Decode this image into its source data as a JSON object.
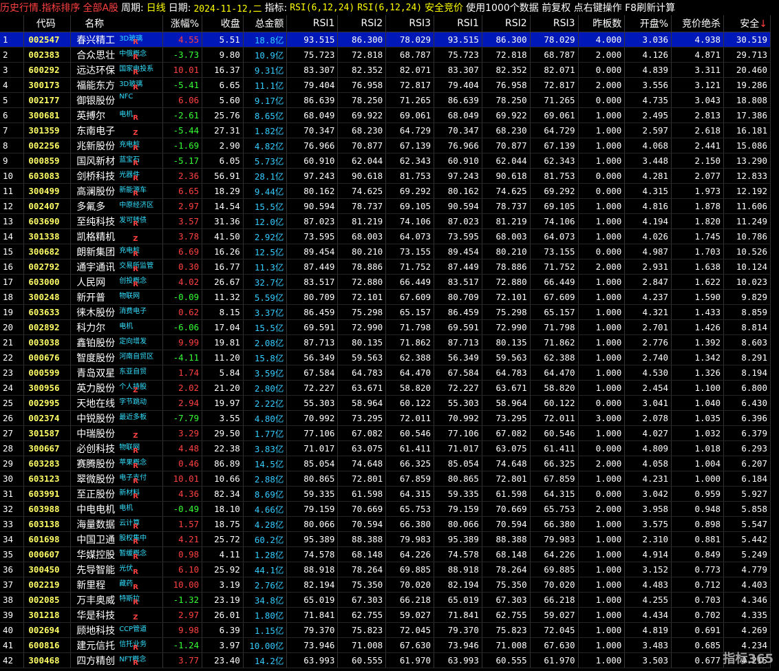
{
  "title_bar": {
    "mode": "历史行情.指标排序",
    "scope": "全部A股",
    "period_label": "周期:",
    "period_value": "日线",
    "date_label": "日期:",
    "date_value": "2024-11-12,二",
    "indicator_label": "指标:",
    "indicator_value": "RSI(6,12,24)",
    "indicator_value2": "RSI(6,12,24)",
    "strategy": "安全竞价",
    "info": "使用1000个数据 前复权 点右键操作 F8刷新计算"
  },
  "columns": [
    "",
    "代码",
    "名称",
    "涨幅%",
    "收盘",
    "总金额",
    "RSI1",
    "RSI2",
    "RSI3",
    "RSI1",
    "RSI2",
    "RSI3",
    "昨板数",
    "开盘%",
    "竞价绝杀",
    "安全"
  ],
  "sort_indicator": "↓",
  "colors": {
    "up": "#ff4040",
    "down": "#33ff33",
    "code": "#ffff66",
    "amount": "#33ccff",
    "tag": "#33e0ff",
    "selected_row": "#0018b8"
  },
  "rows": [
    {
      "idx": "1",
      "code": "002547",
      "name": "春兴精工",
      "tag": "3D玻璃",
      "mark": "R",
      "chg": "4.55",
      "close": "5.51",
      "amt": "18.8",
      "unit": "亿",
      "r1": "93.515",
      "r2": "86.300",
      "r3": "78.029",
      "r4": "93.515",
      "r5": "86.300",
      "r6": "78.029",
      "boards": "4.000",
      "open": "3.036",
      "auction": "4.938",
      "safe": "30.519"
    },
    {
      "idx": "2",
      "code": "002383",
      "name": "合众思壮",
      "tag": "中俄概念",
      "mark": "R",
      "chg": "-3.73",
      "close": "9.80",
      "amt": "10.9",
      "unit": "亿",
      "r1": "75.723",
      "r2": "72.818",
      "r3": "68.787",
      "r4": "75.723",
      "r5": "72.818",
      "r6": "68.787",
      "boards": "2.000",
      "open": "4.126",
      "auction": "4.871",
      "safe": "29.713"
    },
    {
      "idx": "3",
      "code": "600292",
      "name": "远达环保",
      "tag": "国家电投系",
      "mark": "R",
      "chg": "10.01",
      "close": "16.37",
      "amt": "9.31",
      "unit": "亿",
      "r1": "83.307",
      "r2": "82.352",
      "r3": "82.071",
      "r4": "83.307",
      "r5": "82.352",
      "r6": "82.071",
      "boards": "0.000",
      "open": "4.839",
      "auction": "3.311",
      "safe": "20.460"
    },
    {
      "idx": "4",
      "code": "300173",
      "name": "福能东方",
      "tag": "3D玻璃",
      "mark": "R",
      "chg": "-5.41",
      "close": "6.65",
      "amt": "11.1",
      "unit": "亿",
      "r1": "79.404",
      "r2": "76.958",
      "r3": "72.817",
      "r4": "79.404",
      "r5": "76.958",
      "r6": "72.817",
      "boards": "2.000",
      "open": "3.556",
      "auction": "3.121",
      "safe": "19.286"
    },
    {
      "idx": "5",
      "code": "002177",
      "name": "御银股份",
      "tag": "NFC",
      "mark": "",
      "chg": "6.06",
      "close": "5.60",
      "amt": "9.17",
      "unit": "亿",
      "r1": "86.639",
      "r2": "78.250",
      "r3": "71.265",
      "r4": "86.639",
      "r5": "78.250",
      "r6": "71.265",
      "boards": "0.000",
      "open": "4.735",
      "auction": "3.043",
      "safe": "18.808"
    },
    {
      "idx": "6",
      "code": "300681",
      "name": "英搏尔",
      "tag": "电机",
      "mark": "R",
      "chg": "-2.61",
      "close": "25.76",
      "amt": "8.65",
      "unit": "亿",
      "r1": "68.049",
      "r2": "69.922",
      "r3": "69.061",
      "r4": "68.049",
      "r5": "69.922",
      "r6": "69.061",
      "boards": "1.000",
      "open": "2.495",
      "auction": "2.813",
      "safe": "17.386"
    },
    {
      "idx": "7",
      "code": "301359",
      "name": "东南电子",
      "tag": "",
      "mark": "Z",
      "chg": "-5.44",
      "close": "27.31",
      "amt": "1.82",
      "unit": "亿",
      "r1": "70.347",
      "r2": "68.230",
      "r3": "64.729",
      "r4": "70.347",
      "r5": "68.230",
      "r6": "64.729",
      "boards": "1.000",
      "open": "2.597",
      "auction": "2.618",
      "safe": "16.181"
    },
    {
      "idx": "8",
      "code": "002256",
      "name": "兆新股份",
      "tag": "充电桩",
      "mark": "R",
      "chg": "-1.69",
      "close": "2.90",
      "amt": "4.82",
      "unit": "亿",
      "r1": "76.966",
      "r2": "70.877",
      "r3": "67.139",
      "r4": "76.966",
      "r5": "70.877",
      "r6": "67.139",
      "boards": "1.000",
      "open": "4.068",
      "auction": "2.441",
      "safe": "15.086"
    },
    {
      "idx": "9",
      "code": "000859",
      "name": "国风新材",
      "tag": "蓝宝石",
      "mark": "R",
      "chg": "-5.17",
      "close": "6.05",
      "amt": "5.73",
      "unit": "亿",
      "r1": "60.910",
      "r2": "62.044",
      "r3": "62.343",
      "r4": "60.910",
      "r5": "62.044",
      "r6": "62.343",
      "boards": "1.000",
      "open": "3.448",
      "auction": "2.150",
      "safe": "13.290"
    },
    {
      "idx": "10",
      "code": "603083",
      "name": "剑桥科技",
      "tag": "光器件",
      "mark": "R",
      "chg": "2.36",
      "close": "56.91",
      "amt": "28.1",
      "unit": "亿",
      "r1": "97.243",
      "r2": "90.618",
      "r3": "81.753",
      "r4": "97.243",
      "r5": "90.618",
      "r6": "81.753",
      "boards": "0.000",
      "open": "4.281",
      "auction": "2.077",
      "safe": "12.833"
    },
    {
      "idx": "11",
      "code": "300499",
      "name": "高澜股份",
      "tag": "新能源车",
      "mark": "R",
      "chg": "6.65",
      "close": "18.29",
      "amt": "9.44",
      "unit": "亿",
      "r1": "80.162",
      "r2": "74.625",
      "r3": "69.292",
      "r4": "80.162",
      "r5": "74.625",
      "r6": "69.292",
      "boards": "0.000",
      "open": "4.315",
      "auction": "1.973",
      "safe": "12.192"
    },
    {
      "idx": "12",
      "code": "002407",
      "name": "多氟多",
      "tag": "中原经济区",
      "mark": "",
      "chg": "2.97",
      "close": "14.54",
      "amt": "15.5",
      "unit": "亿",
      "r1": "90.594",
      "r2": "78.737",
      "r3": "69.105",
      "r4": "90.594",
      "r5": "78.737",
      "r6": "69.105",
      "boards": "1.000",
      "open": "4.816",
      "auction": "1.878",
      "safe": "11.606"
    },
    {
      "idx": "13",
      "code": "603690",
      "name": "至纯科技",
      "tag": "发可转债",
      "mark": "R",
      "chg": "3.57",
      "close": "31.36",
      "amt": "12.0",
      "unit": "亿",
      "r1": "87.023",
      "r2": "81.219",
      "r3": "74.106",
      "r4": "87.023",
      "r5": "81.219",
      "r6": "74.106",
      "boards": "1.000",
      "open": "4.194",
      "auction": "1.820",
      "safe": "11.249"
    },
    {
      "idx": "14",
      "code": "301338",
      "name": "凯格精机",
      "tag": "",
      "mark": "Z",
      "chg": "3.78",
      "close": "41.50",
      "amt": "2.92",
      "unit": "亿",
      "r1": "73.595",
      "r2": "68.003",
      "r3": "64.073",
      "r4": "73.595",
      "r5": "68.003",
      "r6": "64.073",
      "boards": "1.000",
      "open": "4.026",
      "auction": "1.745",
      "safe": "10.786"
    },
    {
      "idx": "15",
      "code": "300682",
      "name": "朗新集团",
      "tag": "充电桩",
      "mark": "R",
      "chg": "6.69",
      "close": "16.26",
      "amt": "12.5",
      "unit": "亿",
      "r1": "89.454",
      "r2": "80.210",
      "r3": "73.155",
      "r4": "89.454",
      "r5": "80.210",
      "r6": "73.155",
      "boards": "0.000",
      "open": "4.987",
      "auction": "1.703",
      "safe": "10.526"
    },
    {
      "idx": "16",
      "code": "002792",
      "name": "通宇通讯",
      "tag": "交易所监管",
      "mark": "R",
      "chg": "0.30",
      "close": "16.77",
      "amt": "11.3",
      "unit": "亿",
      "r1": "87.449",
      "r2": "78.886",
      "r3": "71.752",
      "r4": "87.449",
      "r5": "78.886",
      "r6": "71.752",
      "boards": "2.000",
      "open": "2.931",
      "auction": "1.638",
      "safe": "10.124"
    },
    {
      "idx": "17",
      "code": "603000",
      "name": "人民网",
      "tag": "创投概念",
      "mark": "R",
      "chg": "4.02",
      "close": "26.67",
      "amt": "32.7",
      "unit": "亿",
      "r1": "83.517",
      "r2": "72.880",
      "r3": "66.449",
      "r4": "83.517",
      "r5": "72.880",
      "r6": "66.449",
      "boards": "1.000",
      "open": "2.847",
      "auction": "1.622",
      "safe": "10.023"
    },
    {
      "idx": "18",
      "code": "300248",
      "name": "新开普",
      "tag": "物联网",
      "mark": "",
      "chg": "-0.09",
      "close": "11.32",
      "amt": "5.59",
      "unit": "亿",
      "r1": "80.709",
      "r2": "72.101",
      "r3": "67.609",
      "r4": "80.709",
      "r5": "72.101",
      "r6": "67.609",
      "boards": "1.000",
      "open": "4.237",
      "auction": "1.590",
      "safe": "9.829"
    },
    {
      "idx": "19",
      "code": "603633",
      "name": "徕木股份",
      "tag": "消费电子",
      "mark": "",
      "chg": "0.62",
      "close": "8.15",
      "amt": "3.37",
      "unit": "亿",
      "r1": "86.459",
      "r2": "75.298",
      "r3": "65.157",
      "r4": "86.459",
      "r5": "75.298",
      "r6": "65.157",
      "boards": "1.000",
      "open": "4.321",
      "auction": "1.433",
      "safe": "8.859"
    },
    {
      "idx": "20",
      "code": "002892",
      "name": "科力尔",
      "tag": "电机",
      "mark": "",
      "chg": "-6.06",
      "close": "17.04",
      "amt": "15.5",
      "unit": "亿",
      "r1": "69.591",
      "r2": "72.990",
      "r3": "71.798",
      "r4": "69.591",
      "r5": "72.990",
      "r6": "71.798",
      "boards": "1.000",
      "open": "2.701",
      "auction": "1.426",
      "safe": "8.814"
    },
    {
      "idx": "21",
      "code": "003038",
      "name": "鑫铂股份",
      "tag": "定向增发",
      "mark": "",
      "chg": "9.99",
      "close": "19.81",
      "amt": "2.08",
      "unit": "亿",
      "r1": "87.713",
      "r2": "80.135",
      "r3": "71.862",
      "r4": "87.713",
      "r5": "80.135",
      "r6": "71.862",
      "boards": "1.000",
      "open": "2.776",
      "auction": "1.392",
      "safe": "8.603"
    },
    {
      "idx": "22",
      "code": "000676",
      "name": "智度股份",
      "tag": "河南自贸区",
      "mark": "",
      "chg": "-4.11",
      "close": "11.20",
      "amt": "15.8",
      "unit": "亿",
      "r1": "56.349",
      "r2": "59.563",
      "r3": "62.388",
      "r4": "56.349",
      "r5": "59.563",
      "r6": "62.388",
      "boards": "1.000",
      "open": "2.740",
      "auction": "1.342",
      "safe": "8.291"
    },
    {
      "idx": "23",
      "code": "000599",
      "name": "青岛双星",
      "tag": "东亚自贸",
      "mark": "",
      "chg": "1.74",
      "close": "5.84",
      "amt": "3.59",
      "unit": "亿",
      "r1": "67.584",
      "r2": "64.783",
      "r3": "64.470",
      "r4": "67.584",
      "r5": "64.783",
      "r6": "64.470",
      "boards": "1.000",
      "open": "4.530",
      "auction": "1.326",
      "safe": "8.194"
    },
    {
      "idx": "24",
      "code": "300956",
      "name": "英力股份",
      "tag": "个人持股",
      "mark": "Z",
      "chg": "2.02",
      "close": "21.20",
      "amt": "2.80",
      "unit": "亿",
      "r1": "72.227",
      "r2": "63.671",
      "r3": "58.820",
      "r4": "72.227",
      "r5": "63.671",
      "r6": "58.820",
      "boards": "1.000",
      "open": "2.454",
      "auction": "1.100",
      "safe": "6.800"
    },
    {
      "idx": "25",
      "code": "002995",
      "name": "天地在线",
      "tag": "字节跳动",
      "mark": "",
      "chg": "2.94",
      "close": "19.97",
      "amt": "2.22",
      "unit": "亿",
      "r1": "55.303",
      "r2": "58.964",
      "r3": "60.122",
      "r4": "55.303",
      "r5": "58.964",
      "r6": "60.122",
      "boards": "0.000",
      "open": "3.041",
      "auction": "1.040",
      "safe": "6.430"
    },
    {
      "idx": "26",
      "code": "002374",
      "name": "中锐股份",
      "tag": "最近多板",
      "mark": "",
      "chg": "-7.79",
      "close": "3.55",
      "amt": "4.80",
      "unit": "亿",
      "r1": "70.992",
      "r2": "73.295",
      "r3": "72.011",
      "r4": "70.992",
      "r5": "73.295",
      "r6": "72.011",
      "boards": "3.000",
      "open": "2.078",
      "auction": "1.035",
      "safe": "6.396"
    },
    {
      "idx": "27",
      "code": "301587",
      "name": "中瑞股份",
      "tag": "",
      "mark": "Z",
      "chg": "3.29",
      "close": "29.50",
      "amt": "1.77",
      "unit": "亿",
      "r1": "77.106",
      "r2": "67.082",
      "r3": "60.546",
      "r4": "77.106",
      "r5": "67.082",
      "r6": "60.546",
      "boards": "1.000",
      "open": "4.027",
      "auction": "1.032",
      "safe": "6.379"
    },
    {
      "idx": "28",
      "code": "300667",
      "name": "必创科技",
      "tag": "物联网",
      "mark": "R",
      "chg": "4.48",
      "close": "22.38",
      "amt": "3.83",
      "unit": "亿",
      "r1": "71.017",
      "r2": "63.075",
      "r3": "61.411",
      "r4": "71.017",
      "r5": "63.075",
      "r6": "61.411",
      "boards": "0.000",
      "open": "4.809",
      "auction": "1.018",
      "safe": "6.293"
    },
    {
      "idx": "29",
      "code": "603283",
      "name": "赛腾股份",
      "tag": "苹果概念",
      "mark": "R",
      "chg": "0.46",
      "close": "86.89",
      "amt": "14.5",
      "unit": "亿",
      "r1": "85.054",
      "r2": "74.648",
      "r3": "66.325",
      "r4": "85.054",
      "r5": "74.648",
      "r6": "66.325",
      "boards": "2.000",
      "open": "4.058",
      "auction": "1.004",
      "safe": "6.207"
    },
    {
      "idx": "30",
      "code": "603123",
      "name": "翠微股份",
      "tag": "电子支付",
      "mark": "R",
      "chg": "10.01",
      "close": "10.66",
      "amt": "2.88",
      "unit": "亿",
      "r1": "80.865",
      "r2": "72.801",
      "r3": "67.859",
      "r4": "80.865",
      "r5": "72.801",
      "r6": "67.859",
      "boards": "1.000",
      "open": "4.231",
      "auction": "1.000",
      "safe": "6.184"
    },
    {
      "idx": "31",
      "code": "603991",
      "name": "至正股份",
      "tag": "新材料",
      "mark": "R",
      "chg": "4.36",
      "close": "82.34",
      "amt": "8.69",
      "unit": "亿",
      "r1": "59.335",
      "r2": "61.598",
      "r3": "64.315",
      "r4": "59.335",
      "r5": "61.598",
      "r6": "64.315",
      "boards": "0.000",
      "open": "3.042",
      "auction": "0.959",
      "safe": "5.927"
    },
    {
      "idx": "32",
      "code": "603988",
      "name": "中电电机",
      "tag": "电机",
      "mark": "",
      "chg": "-0.49",
      "close": "18.10",
      "amt": "4.66",
      "unit": "亿",
      "r1": "79.159",
      "r2": "70.669",
      "r3": "65.753",
      "r4": "79.159",
      "r5": "70.669",
      "r6": "65.753",
      "boards": "2.000",
      "open": "3.958",
      "auction": "0.948",
      "safe": "5.858"
    },
    {
      "idx": "33",
      "code": "603138",
      "name": "海量数据",
      "tag": "云计算",
      "mark": "R",
      "chg": "1.57",
      "close": "18.75",
      "amt": "4.28",
      "unit": "亿",
      "r1": "80.066",
      "r2": "70.594",
      "r3": "66.380",
      "r4": "80.066",
      "r5": "70.594",
      "r6": "66.380",
      "boards": "1.000",
      "open": "3.575",
      "auction": "0.898",
      "safe": "5.547"
    },
    {
      "idx": "34",
      "code": "601698",
      "name": "中国卫通",
      "tag": "股权集中",
      "mark": "R",
      "chg": "4.21",
      "close": "25.72",
      "amt": "60.2",
      "unit": "亿",
      "r1": "95.389",
      "r2": "88.388",
      "r3": "79.983",
      "r4": "95.389",
      "r5": "88.388",
      "r6": "79.983",
      "boards": "1.000",
      "open": "2.310",
      "auction": "0.881",
      "safe": "5.442"
    },
    {
      "idx": "35",
      "code": "000607",
      "name": "华媒控股",
      "tag": "暂缓概念",
      "mark": "R",
      "chg": "0.98",
      "close": "4.11",
      "amt": "1.28",
      "unit": "亿",
      "r1": "74.578",
      "r2": "68.148",
      "r3": "64.226",
      "r4": "74.578",
      "r5": "68.148",
      "r6": "64.226",
      "boards": "1.000",
      "open": "4.914",
      "auction": "0.849",
      "safe": "5.249"
    },
    {
      "idx": "36",
      "code": "300450",
      "name": "先导智能",
      "tag": "光伏",
      "mark": "R",
      "chg": "6.10",
      "close": "25.92",
      "amt": "44.1",
      "unit": "亿",
      "r1": "88.918",
      "r2": "78.264",
      "r3": "69.885",
      "r4": "88.918",
      "r5": "78.264",
      "r6": "69.885",
      "boards": "1.000",
      "open": "3.152",
      "auction": "0.773",
      "safe": "4.779"
    },
    {
      "idx": "37",
      "code": "002219",
      "name": "新里程",
      "tag": "藏药",
      "mark": "R",
      "chg": "10.00",
      "close": "3.19",
      "amt": "2.76",
      "unit": "亿",
      "r1": "82.194",
      "r2": "75.350",
      "r3": "70.020",
      "r4": "82.194",
      "r5": "75.350",
      "r6": "70.020",
      "boards": "1.000",
      "open": "4.483",
      "auction": "0.712",
      "safe": "4.403"
    },
    {
      "idx": "38",
      "code": "002085",
      "name": "万丰奥威",
      "tag": "特斯拉",
      "mark": "R",
      "chg": "-1.32",
      "close": "23.19",
      "amt": "34.8",
      "unit": "亿",
      "r1": "65.019",
      "r2": "67.303",
      "r3": "66.218",
      "r4": "65.019",
      "r5": "67.303",
      "r6": "66.218",
      "boards": "1.000",
      "open": "4.255",
      "auction": "0.703",
      "safe": "4.346"
    },
    {
      "idx": "39",
      "code": "301218",
      "name": "华是科技",
      "tag": "",
      "mark": "Z",
      "chg": "2.97",
      "close": "26.01",
      "amt": "1.80",
      "unit": "亿",
      "r1": "71.841",
      "r2": "62.755",
      "r3": "59.027",
      "r4": "71.841",
      "r5": "62.755",
      "r6": "59.027",
      "boards": "1.000",
      "open": "4.434",
      "auction": "0.702",
      "safe": "4.335"
    },
    {
      "idx": "40",
      "code": "002694",
      "name": "顾地科技",
      "tag": "CCP管道",
      "mark": "",
      "chg": "9.98",
      "close": "6.39",
      "amt": "1.15",
      "unit": "亿",
      "r1": "79.370",
      "r2": "75.823",
      "r3": "72.045",
      "r4": "79.370",
      "r5": "75.823",
      "r6": "72.045",
      "boards": "1.000",
      "open": "4.819",
      "auction": "0.691",
      "safe": "4.269"
    },
    {
      "idx": "41",
      "code": "600816",
      "name": "建元信托",
      "tag": "信托业务",
      "mark": "R",
      "chg": "-1.24",
      "close": "3.97",
      "amt": "10.00",
      "unit": "亿",
      "r1": "73.946",
      "r2": "71.008",
      "r3": "67.630",
      "r4": "73.946",
      "r5": "71.008",
      "r6": "67.630",
      "boards": "1.000",
      "open": "3.483",
      "auction": "0.685",
      "safe": "4.234"
    },
    {
      "idx": "42",
      "code": "300468",
      "name": "四方精创",
      "tag": "NFT概念",
      "mark": "R",
      "chg": "3.77",
      "close": "23.40",
      "amt": "14.2",
      "unit": "亿",
      "r1": "63.993",
      "r2": "60.555",
      "r3": "61.970",
      "r4": "63.993",
      "r5": "60.555",
      "r6": "61.970",
      "boards": "1.000",
      "open": "3.503",
      "auction": "0.677",
      "safe": "4.215"
    }
  ],
  "watermark": "指标365"
}
